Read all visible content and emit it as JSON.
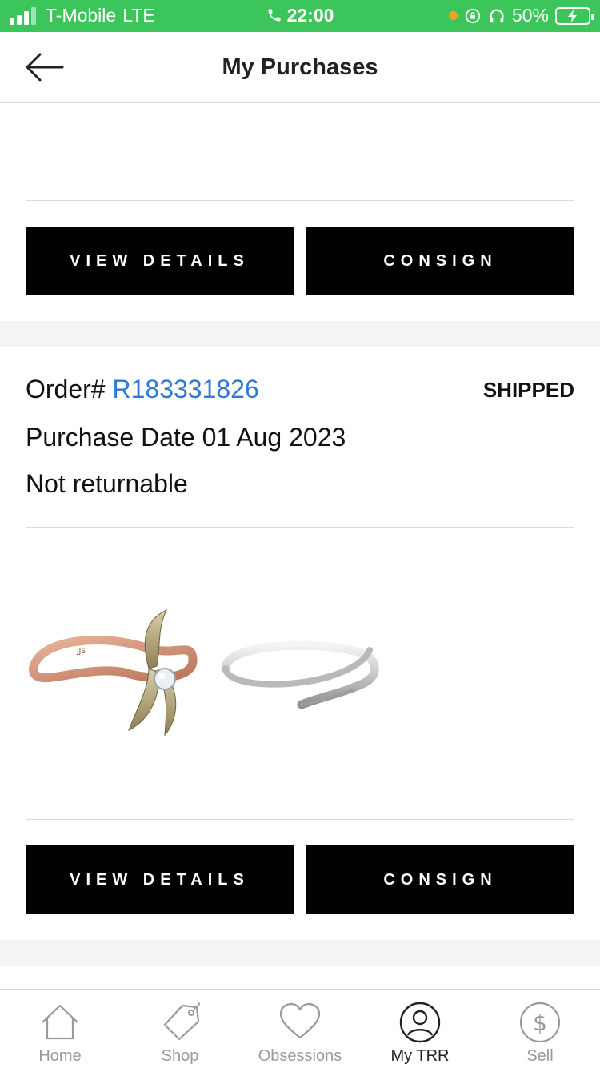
{
  "status_bar": {
    "carrier": "T-Mobile",
    "network": "LTE",
    "time": "22:00",
    "battery": "50%"
  },
  "header": {
    "title": "My Purchases"
  },
  "top_order": {
    "view_details_label": "VIEW DETAILS",
    "consign_label": "CONSIGN"
  },
  "order": {
    "order_prefix": "Order#",
    "order_number": "R183331826",
    "status": "SHIPPED",
    "purchase_date": "Purchase Date 01 Aug 2023",
    "return_policy": "Not returnable",
    "items": [
      {
        "name": "rose-gold-diamond-ring"
      },
      {
        "name": "white-gold-wrap-ring"
      }
    ],
    "view_details_label": "VIEW DETAILS",
    "consign_label": "CONSIGN"
  },
  "tabs": [
    {
      "label": "Home",
      "icon": "home-icon",
      "active": false
    },
    {
      "label": "Shop",
      "icon": "tag-icon",
      "active": false
    },
    {
      "label": "Obsessions",
      "icon": "heart-icon",
      "active": false
    },
    {
      "label": "My TRR",
      "icon": "user-icon",
      "active": true
    },
    {
      "label": "Sell",
      "icon": "dollar-icon",
      "active": false
    }
  ],
  "colors": {
    "status_bar": "#3cc55a",
    "link": "#2f7ad8",
    "button": "#000000"
  }
}
